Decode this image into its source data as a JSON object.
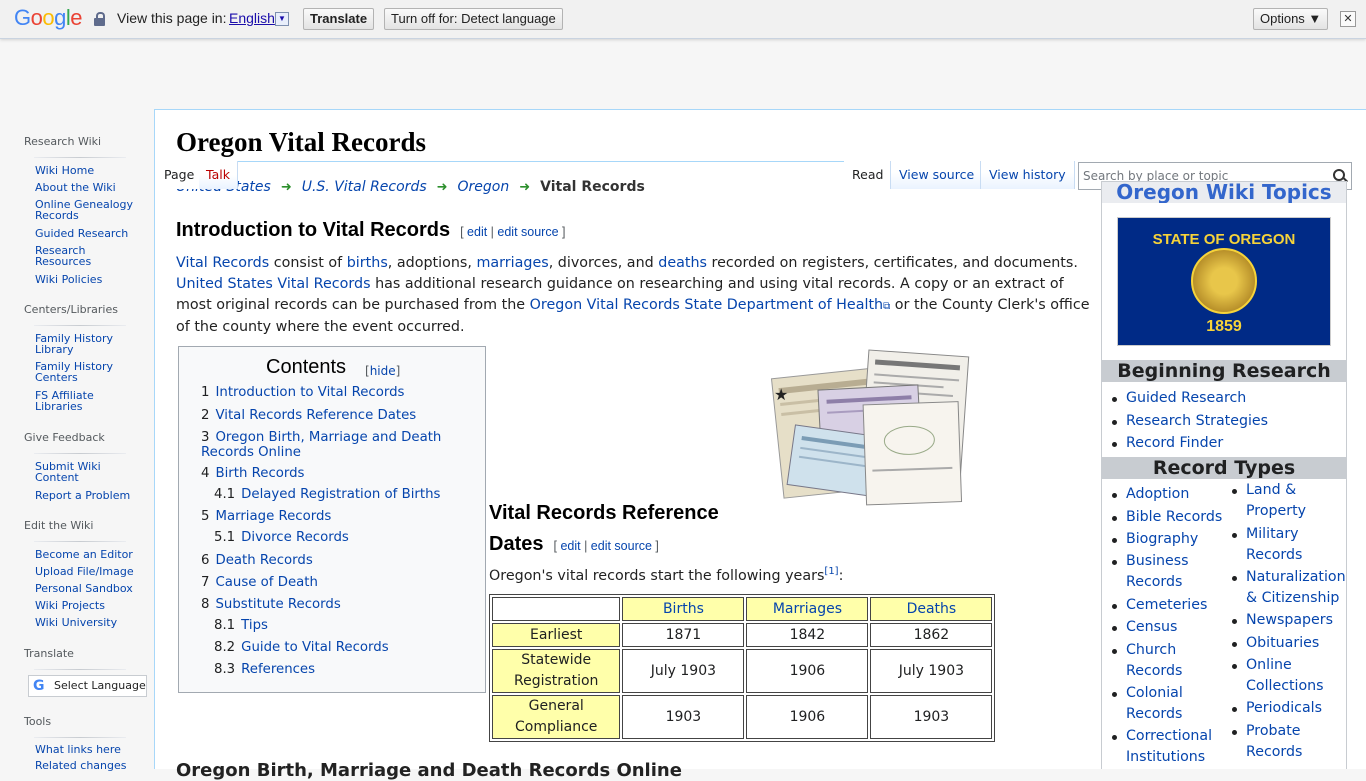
{
  "translate_bar": {
    "logo": "Google",
    "view_label": "View this page in:",
    "language": "English",
    "translate_button": "Translate",
    "turn_off_button": "Turn off for: Detect language",
    "options_button": "Options ▼",
    "close": "✕"
  },
  "sidebar": {
    "sections": [
      {
        "heading": "Research Wiki",
        "items": [
          "Wiki Home",
          "About the Wiki",
          "Online Genealogy Records",
          "Guided Research",
          "Research Resources",
          "Wiki Policies"
        ]
      },
      {
        "heading": "Centers/Libraries",
        "items": [
          "Family History Library",
          "Family History Centers",
          "FS Affiliate Libraries"
        ]
      },
      {
        "heading": "Give Feedback",
        "items": [
          "Submit Wiki Content",
          "Report a Problem"
        ]
      },
      {
        "heading": "Edit the Wiki",
        "items": [
          "Become an Editor",
          "Upload File/Image",
          "Personal Sandbox",
          "Wiki Projects",
          "Wiki University"
        ]
      },
      {
        "heading": "Translate",
        "items": []
      },
      {
        "heading": "Tools",
        "items": [
          "What links here",
          "Related changes"
        ]
      }
    ],
    "select_language": "Select Language"
  },
  "tabs": {
    "page": "Page",
    "talk": "Talk",
    "read": "Read",
    "view_source": "View source",
    "view_history": "View history"
  },
  "search": {
    "placeholder": "Search by place or topic"
  },
  "page_title": "Oregon Vital Records",
  "breadcrumb": [
    "United States",
    "U.S. Vital Records",
    "Oregon",
    "Vital Records"
  ],
  "sections": {
    "intro": {
      "title": "Introduction to Vital Records",
      "edit": "edit",
      "edit_source": "edit source"
    },
    "dates": {
      "title_line1": "Vital Records Reference",
      "title_line2": "Dates",
      "edit": "edit",
      "edit_source": "edit source"
    },
    "next_heading": "Oregon Birth, Marriage and Death Records Online"
  },
  "intro_text": {
    "link_vital_records": "Vital Records",
    "t1": " consist of ",
    "link_births": "births",
    "t2": ", adoptions, ",
    "link_marriages": "marriages",
    "t3": ", divorces, and ",
    "link_deaths": "deaths",
    "t4": " recorded on registers, certificates, and documents. ",
    "link_us_vr": "United States Vital Records",
    "t5": " has additional research guidance on researching and using vital records. A copy or an extract of most original records can be purchased from the ",
    "link_oregon_health": "Oregon Vital Records State Department of Health",
    "t6": " or the County Clerk's office of the county where the event occurred."
  },
  "toc": {
    "title": "Contents",
    "hide": "hide",
    "items": [
      {
        "num": "1",
        "label": "Introduction to Vital Records"
      },
      {
        "num": "2",
        "label": "Vital Records Reference Dates"
      },
      {
        "num": "3",
        "label": "Oregon Birth, Marriage and Death Records Online"
      },
      {
        "num": "4",
        "label": "Birth Records"
      },
      {
        "num": "4.1",
        "label": "Delayed Registration of Births"
      },
      {
        "num": "5",
        "label": "Marriage Records"
      },
      {
        "num": "5.1",
        "label": "Divorce Records"
      },
      {
        "num": "6",
        "label": "Death Records"
      },
      {
        "num": "7",
        "label": "Cause of Death"
      },
      {
        "num": "8",
        "label": "Substitute Records"
      },
      {
        "num": "8.1",
        "label": "Tips"
      },
      {
        "num": "8.2",
        "label": "Guide to Vital Records"
      },
      {
        "num": "8.3",
        "label": "References"
      }
    ]
  },
  "years_text": "Oregon's vital records start the following years",
  "footnote": "[1]",
  "vr_table": {
    "headers": [
      "",
      "Births",
      "Marriages",
      "Deaths"
    ],
    "rows": [
      {
        "label": "Earliest",
        "values": [
          "1871",
          "1842",
          "1862"
        ]
      },
      {
        "label": "Statewide Registration",
        "values": [
          "July 1903",
          "1906",
          "July 1903"
        ]
      },
      {
        "label": "General Compliance",
        "values": [
          "1903",
          "1906",
          "1903"
        ]
      }
    ]
  },
  "topics": {
    "title": "Oregon Wiki Topics",
    "flag_top": "STATE OF OREGON",
    "flag_year": "1859",
    "beginning_heading": "Beginning Research",
    "beginning_links": [
      "Guided Research",
      "Research Strategies",
      "Record Finder"
    ],
    "types_heading": "Record Types",
    "types_col1": [
      "Adoption",
      "Bible Records",
      "Biography",
      "Business Records",
      "Cemeteries",
      "Census",
      "Church Records",
      "Colonial Records",
      "Correctional Institutions"
    ],
    "types_col2": [
      "Land & Property",
      "Military Records",
      "Naturalization & Citizenship",
      "Newspapers",
      "Obituaries",
      "Online Collections",
      "Periodicals",
      "Probate Records"
    ]
  },
  "colors": {
    "link": "#0645ad",
    "table_header_bg": "#ffffaa",
    "breadcrumb_arrow": "#2c8f2c"
  }
}
